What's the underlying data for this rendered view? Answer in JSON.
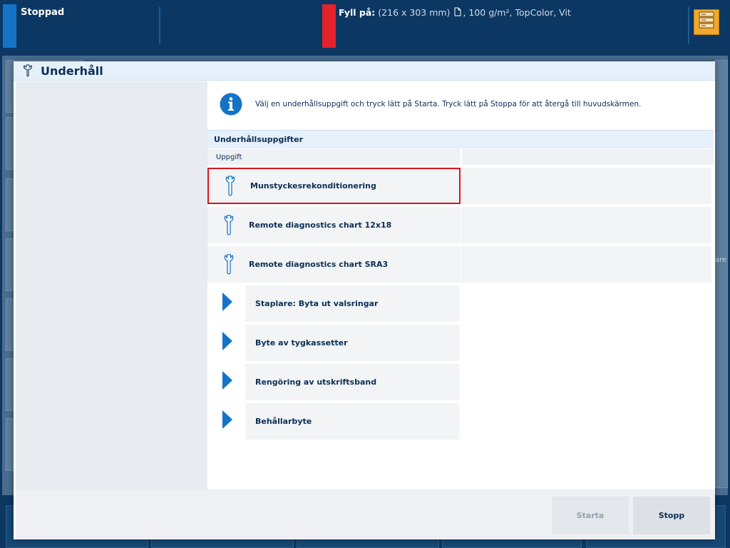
{
  "topbar": {
    "status": "Stoppad",
    "fill_label": "Fyll på:",
    "fill_size": "(216 x 303 mm)",
    "fill_details": ", 100 g/m², TopColor, Vit",
    "status_color": "#1573c7",
    "alert_color": "#e3222c",
    "server_icon": "server-icon"
  },
  "underlay": {
    "fragment": "are"
  },
  "dialog": {
    "title": "Underhåll",
    "info_text": "Välj en underhållsuppgift och tryck lätt på Starta. Tryck lätt på Stoppa för att återgå till huvudskärmen.",
    "section_title": "Underhållsuppgifter",
    "column_header": "Uppgift",
    "tasks": [
      {
        "label": "Munstyckesrekonditionering",
        "icon": "wrench-icon",
        "selected": true
      },
      {
        "label": "Remote diagnostics chart 12x18",
        "icon": "wrench-icon"
      },
      {
        "label": "Remote diagnostics chart SRA3",
        "icon": "wrench-icon"
      }
    ],
    "subtasks": [
      {
        "label": "Staplare: Byta ut valsringar",
        "icon": "play-arrow-icon"
      },
      {
        "label": "Byte av tygkassetter",
        "icon": "play-arrow-icon"
      },
      {
        "label": "Rengöring av utskriftsband",
        "icon": "play-arrow-icon"
      },
      {
        "label": "Behållarbyte",
        "icon": "play-arrow-icon"
      }
    ],
    "buttons": {
      "start": "Starta",
      "stop": "Stopp"
    },
    "selection_color": "#d6141c",
    "accent_color": "#1573c7"
  }
}
